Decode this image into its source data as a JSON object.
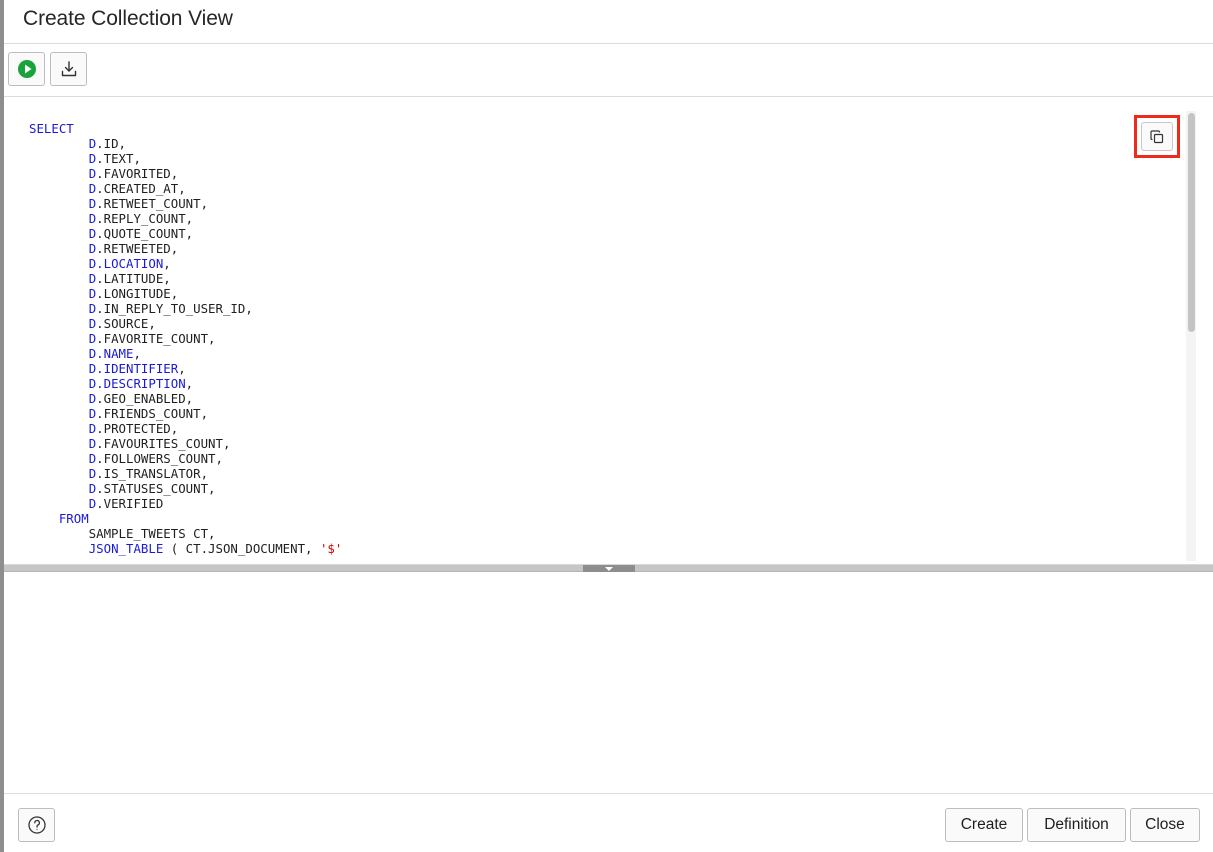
{
  "dialog": {
    "title": "Create Collection View"
  },
  "toolbar": {
    "run_icon": "run-play-icon",
    "download_icon": "download-icon"
  },
  "editor": {
    "copy_icon": "copy-icon",
    "highlight_color": "#ee2b1a",
    "keyword_color": "#1a1ad6",
    "string_color": "#d40000",
    "lines": [
      [
        {
          "t": "SELECT",
          "c": "kw"
        }
      ],
      [
        {
          "t": "        "
        },
        {
          "t": "D",
          "c": "kw"
        },
        {
          "t": ".ID,"
        }
      ],
      [
        {
          "t": "        "
        },
        {
          "t": "D",
          "c": "kw"
        },
        {
          "t": ".TEXT,"
        }
      ],
      [
        {
          "t": "        "
        },
        {
          "t": "D",
          "c": "kw"
        },
        {
          "t": ".FAVORITED,"
        }
      ],
      [
        {
          "t": "        "
        },
        {
          "t": "D",
          "c": "kw"
        },
        {
          "t": ".CREATED_AT,"
        }
      ],
      [
        {
          "t": "        "
        },
        {
          "t": "D",
          "c": "kw"
        },
        {
          "t": ".RETWEET_COUNT,"
        }
      ],
      [
        {
          "t": "        "
        },
        {
          "t": "D",
          "c": "kw"
        },
        {
          "t": ".REPLY_COUNT,"
        }
      ],
      [
        {
          "t": "        "
        },
        {
          "t": "D",
          "c": "kw"
        },
        {
          "t": ".QUOTE_COUNT,"
        }
      ],
      [
        {
          "t": "        "
        },
        {
          "t": "D",
          "c": "kw"
        },
        {
          "t": ".RETWEETED,"
        }
      ],
      [
        {
          "t": "        "
        },
        {
          "t": "D.LOCATION",
          "c": "kw"
        },
        {
          "t": ","
        }
      ],
      [
        {
          "t": "        "
        },
        {
          "t": "D",
          "c": "kw"
        },
        {
          "t": ".LATITUDE,"
        }
      ],
      [
        {
          "t": "        "
        },
        {
          "t": "D",
          "c": "kw"
        },
        {
          "t": ".LONGITUDE,"
        }
      ],
      [
        {
          "t": "        "
        },
        {
          "t": "D",
          "c": "kw"
        },
        {
          "t": ".IN_REPLY_TO_USER_ID,"
        }
      ],
      [
        {
          "t": "        "
        },
        {
          "t": "D",
          "c": "kw"
        },
        {
          "t": ".SOURCE,"
        }
      ],
      [
        {
          "t": "        "
        },
        {
          "t": "D",
          "c": "kw"
        },
        {
          "t": ".FAVORITE_COUNT,"
        }
      ],
      [
        {
          "t": "        "
        },
        {
          "t": "D.NAME",
          "c": "kw"
        },
        {
          "t": ","
        }
      ],
      [
        {
          "t": "        "
        },
        {
          "t": "D.IDENTIFIER",
          "c": "kw"
        },
        {
          "t": ","
        }
      ],
      [
        {
          "t": "        "
        },
        {
          "t": "D.DESCRIPTION",
          "c": "kw"
        },
        {
          "t": ","
        }
      ],
      [
        {
          "t": "        "
        },
        {
          "t": "D",
          "c": "kw"
        },
        {
          "t": ".GEO_ENABLED,"
        }
      ],
      [
        {
          "t": "        "
        },
        {
          "t": "D",
          "c": "kw"
        },
        {
          "t": ".FRIENDS_COUNT,"
        }
      ],
      [
        {
          "t": "        "
        },
        {
          "t": "D",
          "c": "kw"
        },
        {
          "t": ".PROTECTED,"
        }
      ],
      [
        {
          "t": "        "
        },
        {
          "t": "D",
          "c": "kw"
        },
        {
          "t": ".FAVOURITES_COUNT,"
        }
      ],
      [
        {
          "t": "        "
        },
        {
          "t": "D",
          "c": "kw"
        },
        {
          "t": ".FOLLOWERS_COUNT,"
        }
      ],
      [
        {
          "t": "        "
        },
        {
          "t": "D",
          "c": "kw"
        },
        {
          "t": ".IS_TRANSLATOR,"
        }
      ],
      [
        {
          "t": "        "
        },
        {
          "t": "D",
          "c": "kw"
        },
        {
          "t": ".STATUSES_COUNT,"
        }
      ],
      [
        {
          "t": "        "
        },
        {
          "t": "D",
          "c": "kw"
        },
        {
          "t": ".VERIFIED"
        }
      ],
      [
        {
          "t": "    "
        },
        {
          "t": "FROM",
          "c": "kw"
        }
      ],
      [
        {
          "t": "        SAMPLE_TWEETS CT,"
        }
      ],
      [
        {
          "t": "        "
        },
        {
          "t": "JSON_TABLE",
          "c": "kw"
        },
        {
          "t": " ( CT.JSON_DOCUMENT, "
        },
        {
          "t": "'$'",
          "c": "str"
        }
      ]
    ]
  },
  "splitter": {
    "handle_icon": "caret-down-icon"
  },
  "footer": {
    "help_icon": "help-icon",
    "create_label": "Create",
    "definition_label": "Definition",
    "close_label": "Close"
  }
}
